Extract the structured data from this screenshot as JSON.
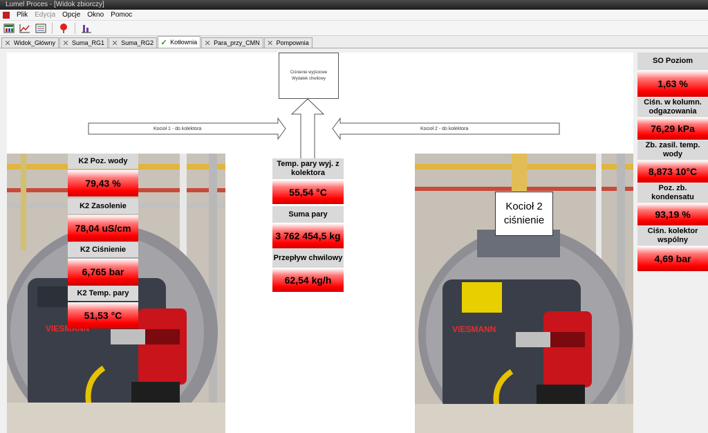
{
  "window": {
    "title": "Lumel Proces - [Widok zbiorczy]"
  },
  "menu": {
    "items": [
      {
        "label": "Plik",
        "enabled": true
      },
      {
        "label": "Edycja",
        "enabled": false
      },
      {
        "label": "Opcje",
        "enabled": true
      },
      {
        "label": "Okno",
        "enabled": true
      },
      {
        "label": "Pomoc",
        "enabled": true
      }
    ]
  },
  "tabs": [
    {
      "label": "Widok_Główny",
      "active": false,
      "icon": "close-icon"
    },
    {
      "label": "Suma_RG1",
      "active": false,
      "icon": "close-icon"
    },
    {
      "label": "Suma_RG2",
      "active": false,
      "icon": "close-icon"
    },
    {
      "label": "Kotłownia",
      "active": true,
      "icon": "checkmark-icon"
    },
    {
      "label": "Para_przy_CMN",
      "active": false,
      "icon": "close-icon"
    },
    {
      "label": "Pompownia",
      "active": false,
      "icon": "close-icon"
    }
  ],
  "diagram": {
    "note_lines": [
      "Ciśnienie wyjściowe",
      "Wydatek chwilowy"
    ],
    "arrow_left_label": "Kocioł 1 - do kolektora",
    "arrow_right_label": "Kocioł 2 - do kolektora"
  },
  "boiler1": {
    "poz_wody": {
      "label": "K2 Poz. wody",
      "value": "79,43 %"
    },
    "zasolenie": {
      "label": "K2 Zasolenie",
      "value": "78,04 uS/cm"
    },
    "cisnienie": {
      "label": "K2 Ciśnienie",
      "value": "6,765 bar"
    },
    "temp_pary": {
      "label": "K2 Temp. pary",
      "value": "51,53 °C"
    },
    "brand": "VIESMANN"
  },
  "center": {
    "temp_pary": {
      "label": "Temp. pary wyj. z kolektora",
      "value": "55,54 °C"
    },
    "suma_pary": {
      "label": "Suma pary",
      "value": "3 762 454,5 kg"
    },
    "przeplyw": {
      "label": "Przepływ chwilowy",
      "value": "62,54 kg/h"
    }
  },
  "boiler2": {
    "callout": "Kocioł 2 ciśnienie",
    "brand": "VIESMANN"
  },
  "right_panel": {
    "so_poziom": {
      "label": "SO Poziom",
      "value": "1,63 %"
    },
    "cisn_kolumny": {
      "label": "Ciśn. w kolumn. odgazowania",
      "value": "76,29 kPa"
    },
    "zb_zasil": {
      "label": "Zb. zasil. temp. wody",
      "value": "8,873 10°C"
    },
    "poz_kond": {
      "label": "Poz. zb. kondensatu",
      "value": "93,19 %"
    },
    "cisn_kolektor": {
      "label": "Ciśn. kolektor wspólny",
      "value": "4,69 bar"
    }
  }
}
